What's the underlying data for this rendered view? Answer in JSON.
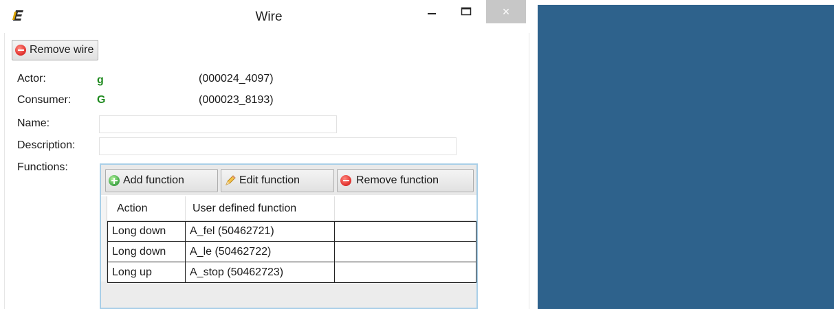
{
  "window": {
    "title": "Wire",
    "icons": {
      "app": "app-e-logo-icon",
      "minimize": "minimize-icon",
      "maximize": "maximize-icon",
      "close": "close-icon"
    },
    "close_glyph": "×"
  },
  "toolbar": {
    "remove_wire_label": "Remove wire"
  },
  "fields": {
    "actor_label": "Actor:",
    "actor_value": "g",
    "actor_id": "(000024_4097)",
    "consumer_label": "Consumer:",
    "consumer_value": "G",
    "consumer_id": "(000023_8193)",
    "name_label": "Name:",
    "name_value": "",
    "description_label": "Description:",
    "description_value": "",
    "functions_label": "Functions:"
  },
  "functions": {
    "add_label": "Add function",
    "edit_label": "Edit function",
    "remove_label": "Remove function",
    "columns": [
      "Action",
      "User defined function"
    ],
    "rows": [
      {
        "action": "Long down",
        "function": "A_fel (50462721)"
      },
      {
        "action": "Long down",
        "function": "A_le (50462722)"
      },
      {
        "action": "Long up",
        "function": "A_stop (50462723)"
      }
    ]
  },
  "colors": {
    "accent_green": "#1f8a1f",
    "background_panel": "#2e628c",
    "selection_border": "#a9cfe8"
  }
}
